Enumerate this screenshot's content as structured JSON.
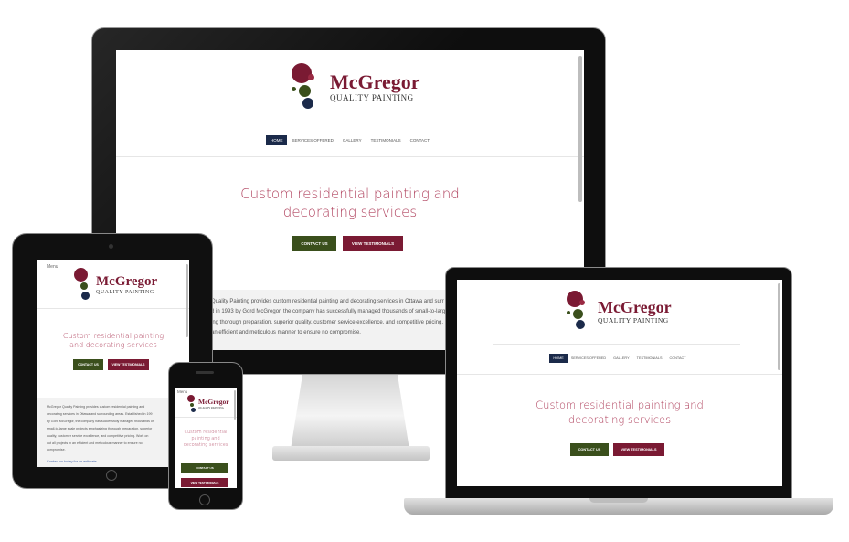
{
  "site": {
    "logo_top": "McGregor",
    "logo_bottom": "QUALITY PAINTING",
    "nav": [
      "HOME",
      "SERVICES OFFERED",
      "GALLERY",
      "TESTIMONIALS",
      "CONTACT"
    ],
    "tagline": "Custom residential painting and decorating services",
    "contact_btn": "CONTACT US",
    "testimonials_btn": "VIEW TESTIMONIALS",
    "menu_label": "Menu",
    "link_text": "Contact us today for an estimate",
    "desktop_paragraph_lines": [
      "Quality Painting provides custom residential painting and decorating services in Ottawa and surr",
      "d in 1993 by Gord McGregor, the company has successfully managed thousands of small-to-large",
      "ing thorough preparation, superior quality, customer service excellence, and competitive pricing. M",
      "an efficient and meticulous manner to ensure no compromise."
    ],
    "tablet_paragraph_lines": [
      "McGregor Quality Painting provides custom residential painting and",
      "decorating services in Ottawa and surrounding areas. Established in 199",
      "by Gord McGregor, the company has successfully managed thousands of",
      "small-to-large scale projects emphasizing thorough preparation, superior",
      "quality, customer service excellence, and competitive pricing. Work on",
      "out all projects in an efficient and meticulous manner to ensure no",
      "compromise."
    ]
  },
  "colors": {
    "brand_burgundy": "#7a1a33",
    "brand_green": "#3a4f1c",
    "nav_active": "#1b2a4a",
    "tagline_pink": "#b0425e"
  }
}
